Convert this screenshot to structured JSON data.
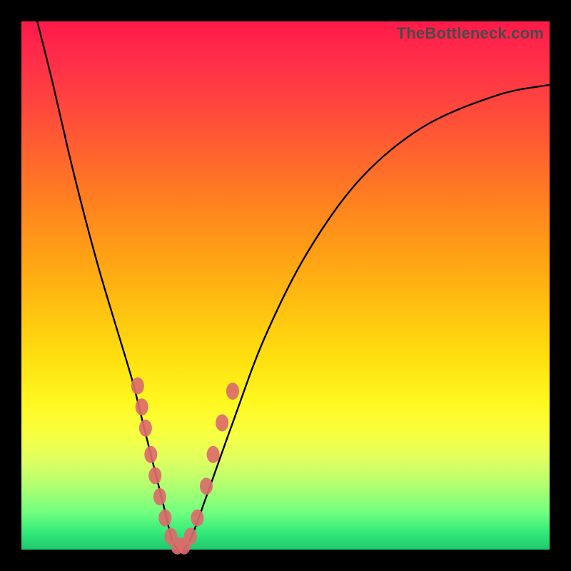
{
  "watermark": "TheBottleneck.com",
  "chart_data": {
    "type": "line",
    "title": "",
    "xlabel": "",
    "ylabel": "",
    "xlim": [
      0,
      100
    ],
    "ylim": [
      0,
      100
    ],
    "series": [
      {
        "name": "curve",
        "x": [
          3,
          6,
          9,
          12,
          15,
          18,
          21,
          23,
          25,
          27,
          28.5,
          30,
          32,
          35,
          40,
          46,
          54,
          64,
          76,
          90,
          100
        ],
        "y": [
          100,
          88,
          75,
          63,
          52,
          42,
          32,
          24,
          16,
          8,
          2,
          0,
          2,
          10,
          24,
          40,
          56,
          70,
          80,
          86,
          88
        ]
      }
    ],
    "markers": [
      {
        "x": 22.0,
        "y": 31
      },
      {
        "x": 22.8,
        "y": 27
      },
      {
        "x": 23.5,
        "y": 23
      },
      {
        "x": 24.5,
        "y": 18
      },
      {
        "x": 25.3,
        "y": 14
      },
      {
        "x": 26.2,
        "y": 10
      },
      {
        "x": 27.2,
        "y": 6
      },
      {
        "x": 28.3,
        "y": 2.5
      },
      {
        "x": 29.5,
        "y": 0.7
      },
      {
        "x": 30.8,
        "y": 0.7
      },
      {
        "x": 32.0,
        "y": 2.5
      },
      {
        "x": 33.3,
        "y": 6
      },
      {
        "x": 35.0,
        "y": 12
      },
      {
        "x": 36.3,
        "y": 18
      },
      {
        "x": 38.0,
        "y": 24
      },
      {
        "x": 40.0,
        "y": 30
      }
    ],
    "colors": {
      "curve_stroke": "#000000",
      "marker_fill": "#db6b6b",
      "gradient_top": "#ff1a4a",
      "gradient_bottom": "#20c870"
    }
  }
}
